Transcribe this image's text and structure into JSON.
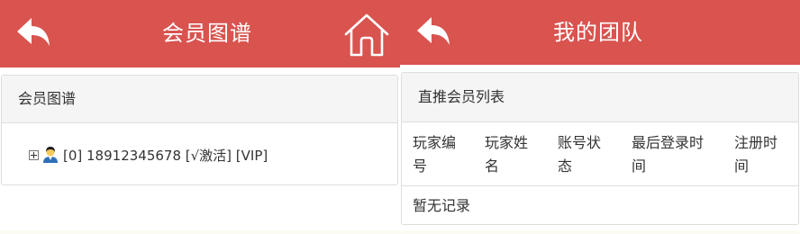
{
  "colors": {
    "header_bg": "#d9534f",
    "panel_head_bg": "#f5f5f5",
    "border": "#dddddd",
    "text": "#333333"
  },
  "left_screen": {
    "header": {
      "back_icon": "back-arrow-icon",
      "title": "会员图谱",
      "home_icon": "home-icon"
    },
    "panel": {
      "heading": "会员图谱",
      "tree_node": {
        "expand_icon": "plus-box-icon",
        "avatar_icon": "user-avatar-icon",
        "text": "[0] 18912345678 [√激活] [VIP]"
      }
    }
  },
  "right_screen": {
    "header": {
      "back_icon": "back-arrow-icon",
      "title": "我的团队"
    },
    "panel": {
      "heading": "直推会员列表",
      "columns": [
        {
          "line1": "玩家编",
          "line2": "号"
        },
        {
          "line1": "玩家姓",
          "line2": "名"
        },
        {
          "line1": "账号状",
          "line2": "态"
        },
        {
          "line1": "最后登录时",
          "line2": "间"
        },
        {
          "line1": "注册时",
          "line2": "间"
        }
      ],
      "empty_text": "暂无记录"
    }
  }
}
